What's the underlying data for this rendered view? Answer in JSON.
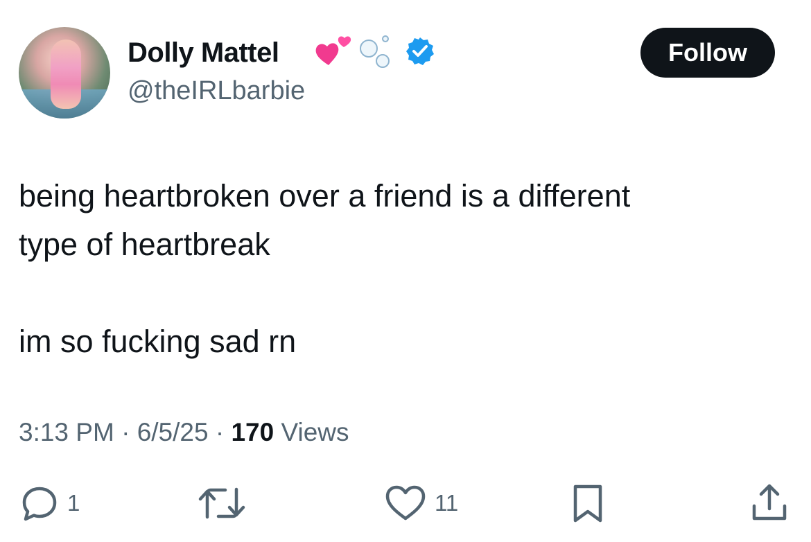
{
  "tweet": {
    "author": {
      "display_name": "Dolly Mattel",
      "handle": "@theIRLbarbie",
      "name_emojis": [
        "two-hearts-emoji",
        "bubbles-emoji"
      ],
      "verified": true,
      "verified_color": "#1d9bf0"
    },
    "follow_label": "Follow",
    "text": {
      "line1": "being heartbroken over a friend is a different",
      "line2": "type of heartbreak",
      "line3": "im so fucking sad rn"
    },
    "meta": {
      "time": "3:13 PM",
      "separator": "·",
      "date": "6/5/25",
      "views_count": "170",
      "views_label": "Views"
    },
    "actions": {
      "reply_count": "1",
      "retweet_count": "",
      "like_count": "11",
      "icons": [
        "reply-icon",
        "retweet-icon",
        "like-icon",
        "bookmark-icon",
        "share-icon"
      ]
    }
  }
}
